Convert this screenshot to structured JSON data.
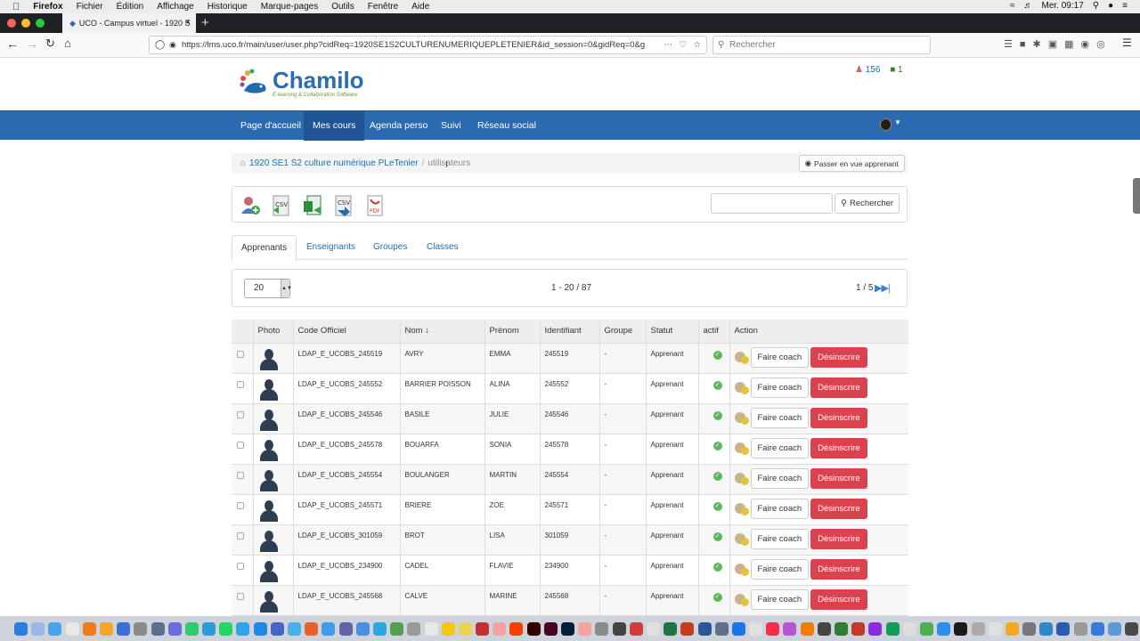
{
  "menubar": {
    "app": "Firefox",
    "items": [
      "Fichier",
      "Édition",
      "Affichage",
      "Historique",
      "Marque-pages",
      "Outils",
      "Fenêtre",
      "Aide"
    ],
    "clock": "Mer. 09:17"
  },
  "browser": {
    "tab_title": "UCO - Campus virtuel - 1920 S",
    "url": "https://lms.uco.fr/main/user/user.php?cidReq=1920SE1S2CULTURENUMERIQUEPLETENIER&id_session=0&gidReq=0&g",
    "search_placeholder": "Rechercher"
  },
  "header": {
    "logo_title": "Chamilo",
    "logo_subtitle": "E-learning & Collaboration Software",
    "users_count": "156",
    "messages_count": "1"
  },
  "nav": {
    "items": [
      "Page d'accueil",
      "Mes cours",
      "Agenda perso",
      "Suivi",
      "Réseau social"
    ],
    "active": "Mes cours"
  },
  "breadcrumb": {
    "course": "1920 SE1 S2 culture numérique PLeTenier",
    "current": "utilisateurs",
    "student_view_button": "Passer en vue apprenant"
  },
  "toolbar": {
    "icons": [
      "add-user-icon",
      "import-csv-icon",
      "export-excel-icon",
      "export-csv-icon",
      "export-pdf-icon"
    ],
    "search_button": "Rechercher"
  },
  "tabs": [
    "Apprenants",
    "Enseignants",
    "Groupes",
    "Classes"
  ],
  "pager": {
    "per_page": "20",
    "range": "1 - 20 / 87",
    "page": "1 / 5"
  },
  "table": {
    "columns": [
      "",
      "Photo",
      "Code Officiel",
      "Nom ↓",
      "Prénom",
      "Identifiant",
      "Groupe",
      "Statut",
      "actif",
      "Action"
    ],
    "coach_label": "Faire coach",
    "unsubscribe_label": "Désinscrire",
    "rows": [
      {
        "code": "LDAP_E_UCOBS_245519",
        "nom": "AVRY",
        "prenom": "EMMA",
        "id": "245519",
        "groupe": "-",
        "statut": "Apprenant"
      },
      {
        "code": "LDAP_E_UCOBS_245552",
        "nom": "BARRIER POISSON",
        "prenom": "ALINA",
        "id": "245552",
        "groupe": "-",
        "statut": "Apprenant"
      },
      {
        "code": "LDAP_E_UCOBS_245546",
        "nom": "BASILE",
        "prenom": "JULIE",
        "id": "245546",
        "groupe": "-",
        "statut": "Apprenant"
      },
      {
        "code": "LDAP_E_UCOBS_245578",
        "nom": "BOUARFA",
        "prenom": "SONIA",
        "id": "245578",
        "groupe": "-",
        "statut": "Apprenant"
      },
      {
        "code": "LDAP_E_UCOBS_245554",
        "nom": "BOULANGER",
        "prenom": "MARTIN",
        "id": "245554",
        "groupe": "-",
        "statut": "Apprenant"
      },
      {
        "code": "LDAP_E_UCOBS_245571",
        "nom": "BRIERE",
        "prenom": "ZOE",
        "id": "245571",
        "groupe": "-",
        "statut": "Apprenant"
      },
      {
        "code": "LDAP_E_UCOBS_301059",
        "nom": "BROT",
        "prenom": "LISA",
        "id": "301059",
        "groupe": "-",
        "statut": "Apprenant"
      },
      {
        "code": "LDAP_E_UCOBS_234900",
        "nom": "CADEL",
        "prenom": "FLAVIE",
        "id": "234900",
        "groupe": "-",
        "statut": "Apprenant"
      },
      {
        "code": "LDAP_E_UCOBS_245568",
        "nom": "CALVE",
        "prenom": "MARINE",
        "id": "245568",
        "groupe": "-",
        "statut": "Apprenant"
      }
    ]
  },
  "colors": {
    "nav_bg": "#2c6ab0",
    "nav_active": "#1f5594",
    "link": "#1a6db8",
    "danger": "#d9434e",
    "success": "#5cb85c"
  }
}
